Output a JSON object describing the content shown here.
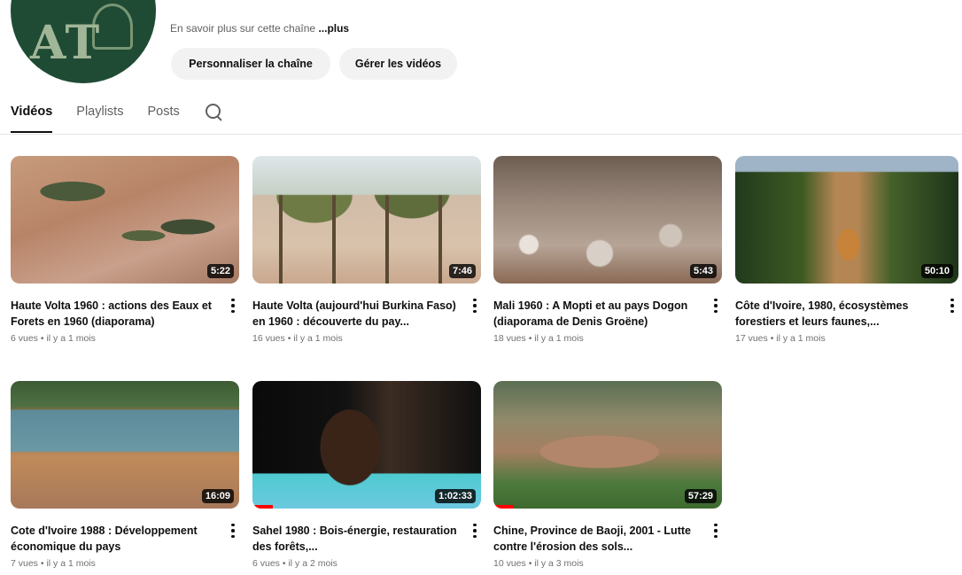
{
  "channel": {
    "about_text": "En savoir plus sur cette chaîne",
    "about_more": "...plus",
    "logo_letters": "AT",
    "buttons": {
      "customize": "Personnaliser la chaîne",
      "manage": "Gérer les vidéos"
    }
  },
  "tabs": [
    {
      "label": "Vidéos",
      "active": true
    },
    {
      "label": "Playlists",
      "active": false
    },
    {
      "label": "Posts",
      "active": false
    }
  ],
  "videos": [
    {
      "title": "Haute Volta 1960 : actions des Eaux et Forets en 1960 (diaporama)",
      "duration": "5:22",
      "meta": "6 vues • il y a 1 mois",
      "progress_pct": 0
    },
    {
      "title": "Haute Volta (aujourd'hui Burkina Faso) en 1960 : découverte du pay...",
      "duration": "7:46",
      "meta": "16 vues • il y a 1 mois",
      "progress_pct": 0
    },
    {
      "title": "Mali 1960 : A Mopti et au pays Dogon (diaporama de Denis Groëne)",
      "duration": "5:43",
      "meta": "18 vues • il y a 1 mois",
      "progress_pct": 0
    },
    {
      "title": "Côte d'Ivoire, 1980, écosystèmes forestiers et leurs faunes,...",
      "duration": "50:10",
      "meta": "17 vues • il y a 1 mois",
      "progress_pct": 0
    },
    {
      "title": "Cote d'Ivoire 1988 : Développement économique du pays",
      "duration": "16:09",
      "meta": "7 vues • il y a 1 mois",
      "progress_pct": 0
    },
    {
      "title": "Sahel 1980 : Bois-énergie, restauration des forêts,...",
      "duration": "1:02:33",
      "meta": "6 vues • il y a 2 mois",
      "progress_pct": 9
    },
    {
      "title": "Chine, Province de Baoji, 2001 - Lutte contre l'érosion des sols...",
      "duration": "57:29",
      "meta": "10 vues • il y a 3 mois",
      "progress_pct": 9
    }
  ],
  "colors": {
    "progress": "#ff0000",
    "avatar_bg": "#1f4b35"
  }
}
